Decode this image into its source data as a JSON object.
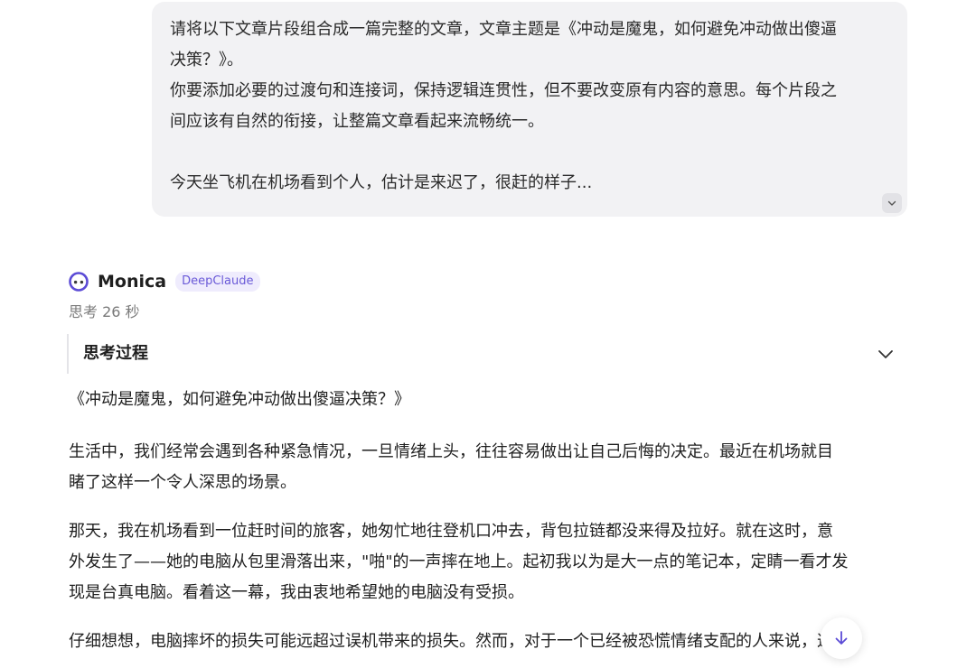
{
  "user_message": {
    "lines": [
      "请将以下文章片段组合成一篇完整的文章，文章主题是《冲动是魔鬼，如何避免冲动做出傻逼",
      "决策？》。",
      "你要添加必要的过渡句和连接词，保持逻辑连贯性，但不要改变原有内容的意思。每个片段之",
      "间应该有自然的衔接，让整篇文章看起来流畅统一。",
      "今天坐飞机在机场看到个人，估计是来迟了，很赶的样子..."
    ],
    "expand_icon": "chevron-down-icon"
  },
  "assistant": {
    "name": "Monica",
    "model_badge": "DeepClaude",
    "avatar_icon": "monica-avatar-icon",
    "think_time": "思考 26 秒",
    "thinking_title": "思考过程",
    "thinking_toggle_icon": "chevron-down-icon"
  },
  "answer": {
    "title": "《冲动是魔鬼，如何避免冲动做出傻逼决策？》",
    "paragraphs": [
      [
        "生活中，我们经常会遇到各种紧急情况，一旦情绪上头，往往容易做出让自己后悔的决定。最近在机场就目",
        "睹了这样一个令人深思的场景。"
      ],
      [
        "那天，我在机场看到一位赶时间的旅客，她匆忙地往登机口冲去，背包拉链都没来得及拉好。就在这时，意",
        "外发生了——她的电脑从包里滑落出来，\"啪\"的一声摔在地上。起初我以为是大一点的笔记本，定睛一看才发",
        "现是台真电脑。看着这一幕，我由衷地希望她的电脑没有受损。"
      ],
      [
        "仔细想想，电脑摔坏的损失可能远超过误机带来的损失。然而，对于一个已经被恐慌情绪支配的人来说，这"
      ]
    ]
  },
  "scroll_button": {
    "icon": "arrow-down-icon"
  },
  "colors": {
    "user_bubble_bg": "#f2f2f4",
    "badge_text": "#6a5ad8",
    "badge_bg": "#efecfd",
    "accent": "#5b4bd6"
  }
}
